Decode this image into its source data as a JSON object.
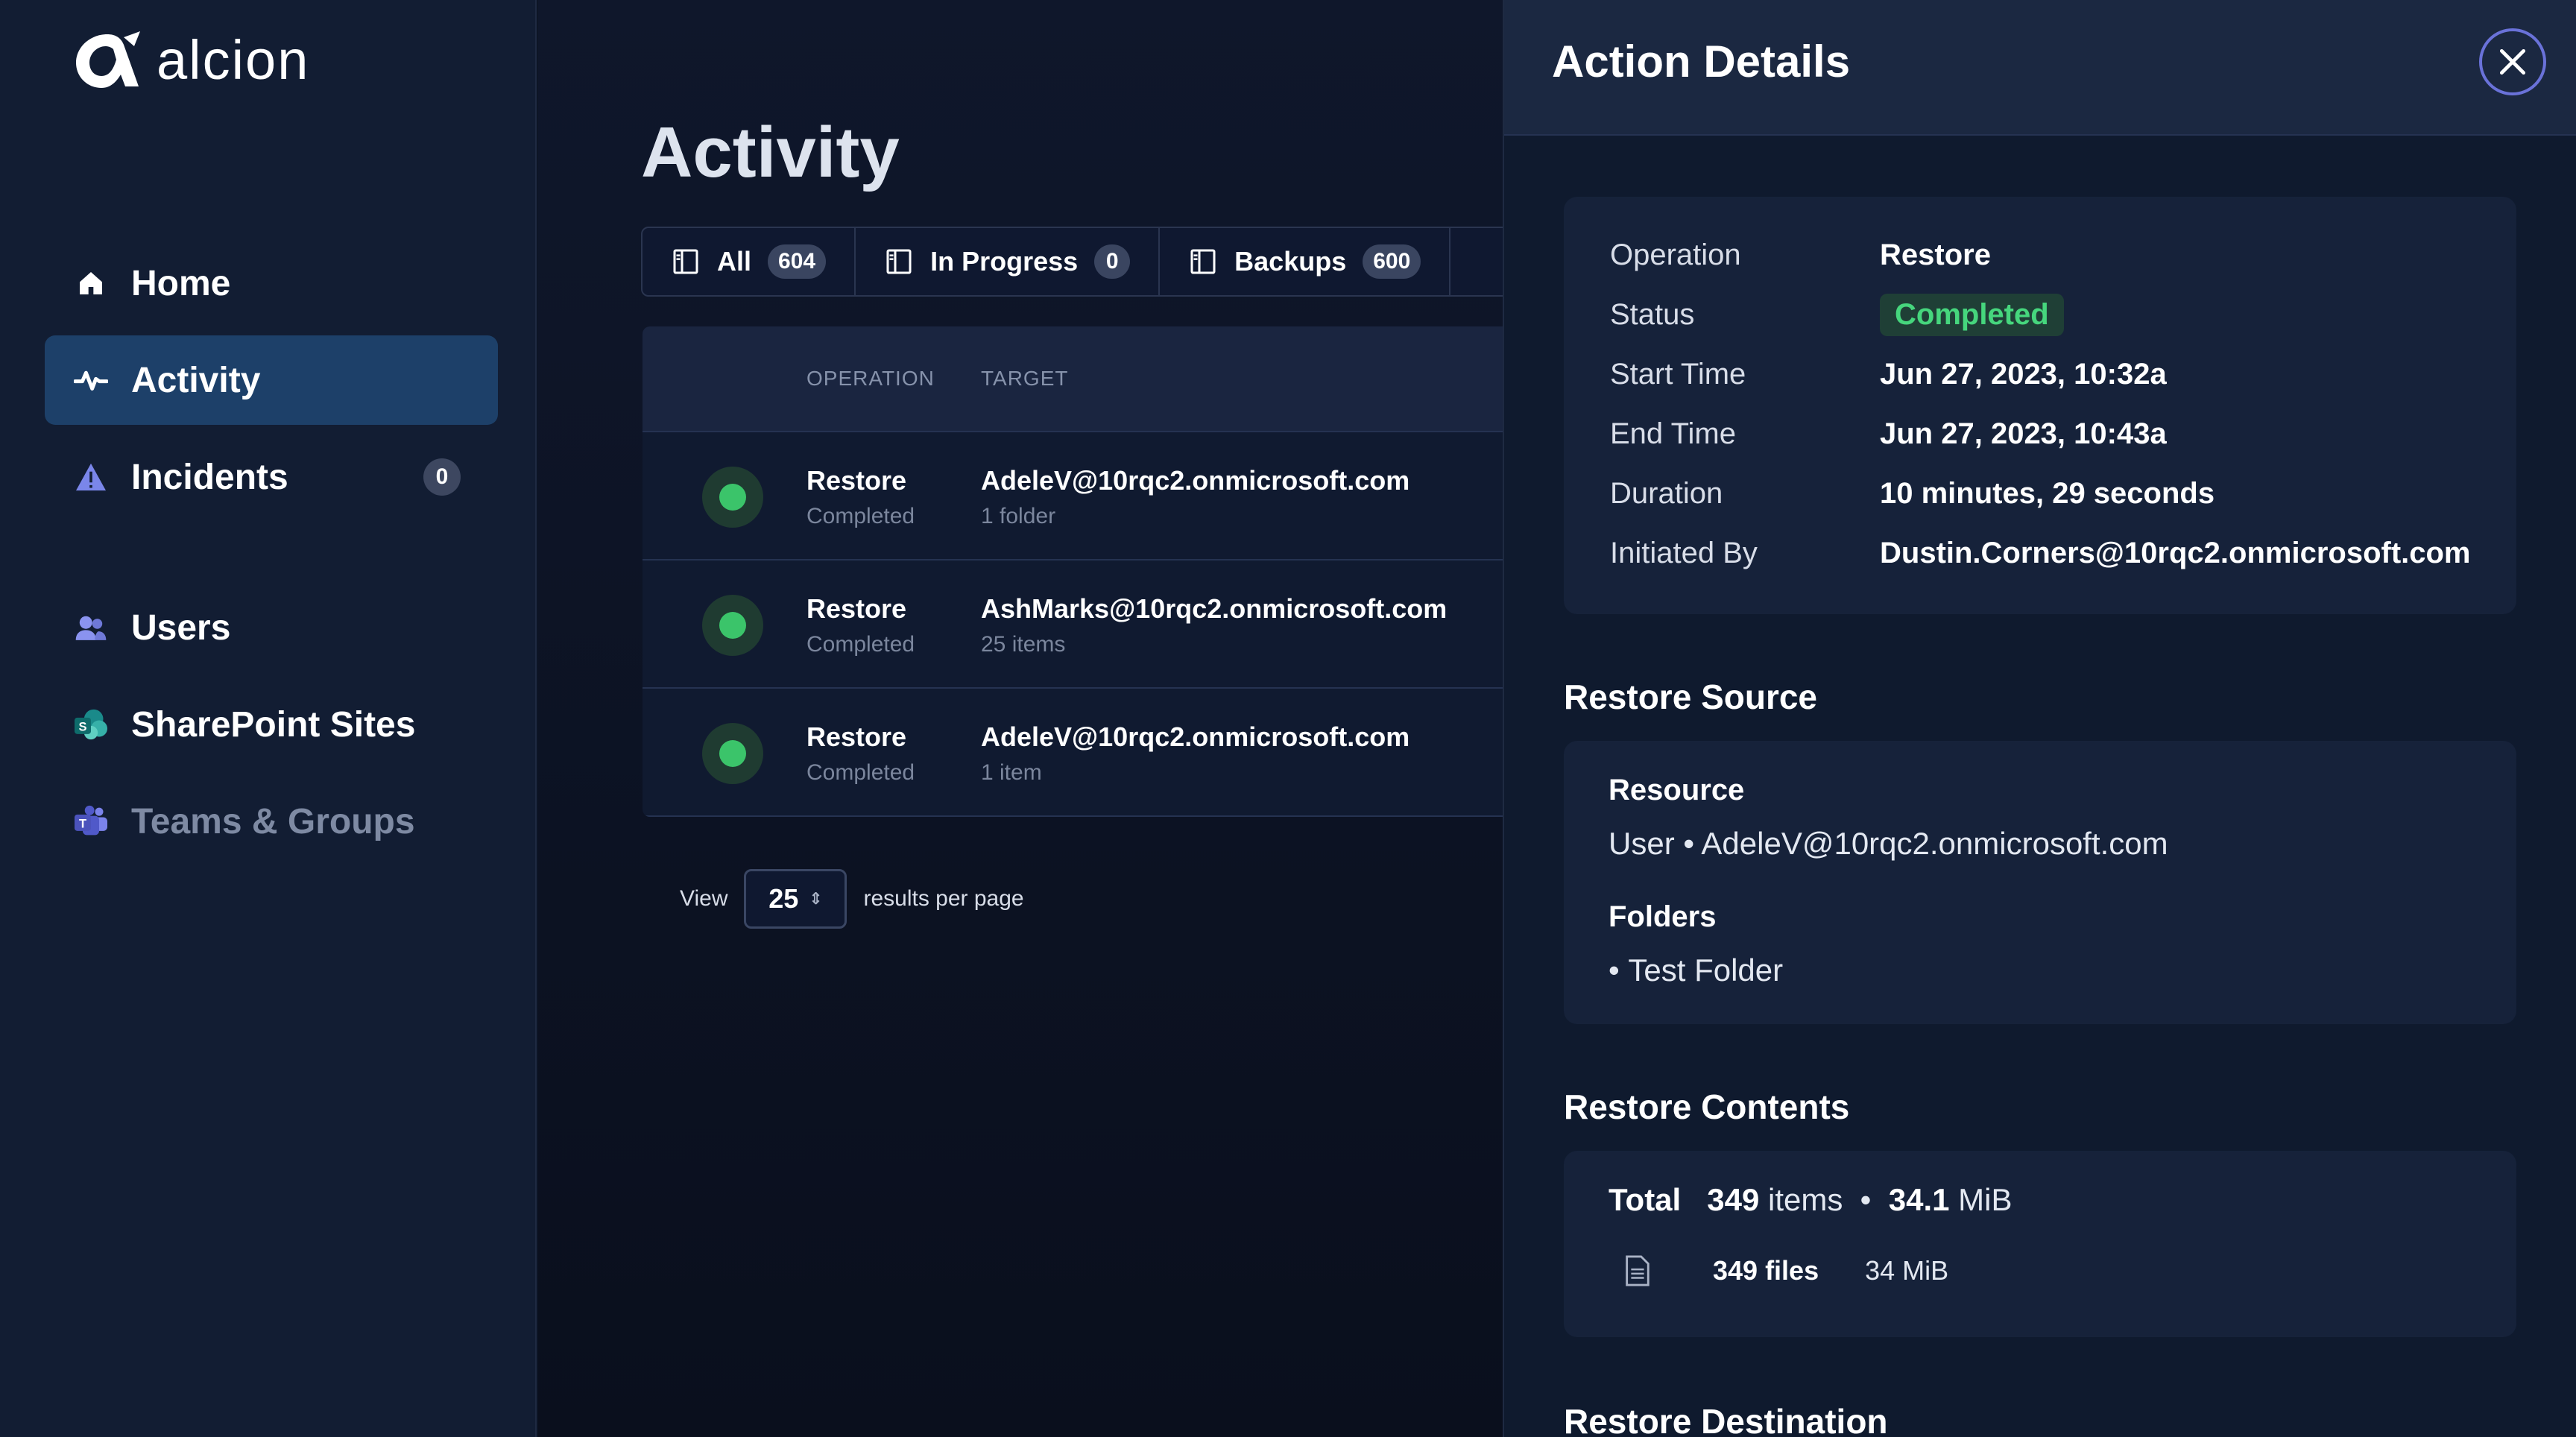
{
  "brand": {
    "name": "alcion"
  },
  "nav": {
    "items": [
      {
        "label": "Home",
        "icon": "home-icon"
      },
      {
        "label": "Activity",
        "icon": "activity-icon",
        "active": true
      },
      {
        "label": "Incidents",
        "icon": "warning-icon",
        "badge": "0"
      },
      {
        "label": "Users",
        "icon": "users-icon"
      },
      {
        "label": "SharePoint Sites",
        "icon": "sharepoint-icon"
      },
      {
        "label": "Teams & Groups",
        "icon": "teams-icon"
      }
    ]
  },
  "main": {
    "title": "Activity",
    "tabs": [
      {
        "label": "All",
        "count": "604"
      },
      {
        "label": "In Progress",
        "count": "0"
      },
      {
        "label": "Backups",
        "count": "600"
      }
    ],
    "table": {
      "headers": {
        "operation": "OPERATION",
        "target": "TARGET"
      },
      "rows": [
        {
          "operation": "Restore",
          "status": "Completed",
          "target": "AdeleV@10rqc2.onmicrosoft.com",
          "detail": "1 folder"
        },
        {
          "operation": "Restore",
          "status": "Completed",
          "target": "AshMarks@10rqc2.onmicrosoft.com",
          "detail": "25 items"
        },
        {
          "operation": "Restore",
          "status": "Completed",
          "target": "AdeleV@10rqc2.onmicrosoft.com",
          "detail": "1 item"
        }
      ]
    },
    "pager": {
      "view_label": "View",
      "page_size": "25",
      "suffix": "results per page"
    }
  },
  "details": {
    "title": "Action Details",
    "fields": [
      {
        "key": "Operation",
        "value": "Restore"
      },
      {
        "key": "Status",
        "value": "Completed"
      },
      {
        "key": "Start Time",
        "value": "Jun 27, 2023, 10:32a"
      },
      {
        "key": "End Time",
        "value": "Jun 27, 2023, 10:43a"
      },
      {
        "key": "Duration",
        "value": "10 minutes, 29 seconds"
      },
      {
        "key": "Initiated By",
        "value": "Dustin.Corners@10rqc2.onmicrosoft.com"
      }
    ],
    "source": {
      "title": "Restore Source",
      "resource_label": "Resource",
      "resource_value": "User • AdeleV@10rqc2.onmicrosoft.com",
      "folders_label": "Folders",
      "folder_item": "Test Folder"
    },
    "contents": {
      "title": "Restore Contents",
      "total_label": "Total",
      "total_count": "349",
      "items_word": "items",
      "total_size": "34.1",
      "size_unit": "MiB",
      "files_label": "349 files",
      "files_size": "34 MiB"
    },
    "destination": {
      "title": "Restore Destination"
    }
  },
  "colors": {
    "accent": "#1d4069",
    "success": "#3bc46a",
    "close_ring": "#6a72d9"
  }
}
